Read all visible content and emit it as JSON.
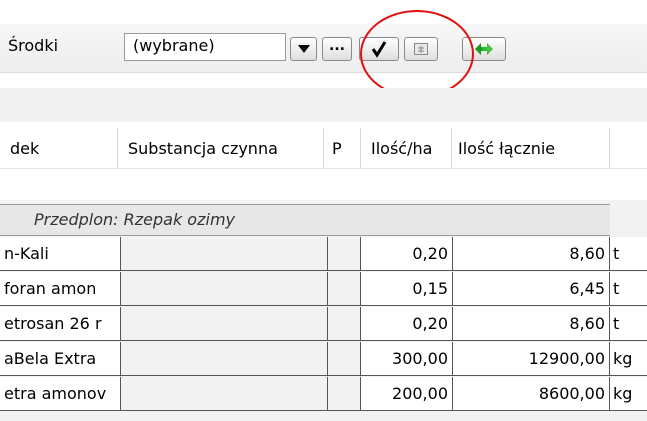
{
  "toolbar": {
    "label": "Środki",
    "combo_value": "(wybrane)",
    "more_button_label": "...",
    "check_icon": "check-icon",
    "grid_icon": "grid-icon",
    "refresh_icon": "refresh-arrows-icon",
    "highlight_color": "#e01010"
  },
  "table": {
    "columns": [
      "dek",
      "Substancja czynna",
      "P",
      "Ilość/ha",
      "Ilość łącznie"
    ],
    "group_label": "Przedplon: Rzepak ozimy",
    "rows": [
      {
        "name": "n-Kali",
        "substance": "",
        "p": "",
        "per_ha": "0,20",
        "total": "8,60",
        "unit": "t"
      },
      {
        "name": "foran amon",
        "substance": "",
        "p": "",
        "per_ha": "0,15",
        "total": "6,45",
        "unit": "t"
      },
      {
        "name": "etrosan 26 r",
        "substance": "",
        "p": "",
        "per_ha": "0,20",
        "total": "8,60",
        "unit": "t"
      },
      {
        "name": "aBela Extra",
        "substance": "",
        "p": "",
        "per_ha": "300,00",
        "total": "12900,00",
        "unit": "kg"
      },
      {
        "name": "etra amonov",
        "substance": "",
        "p": "",
        "per_ha": "200,00",
        "total": "8600,00",
        "unit": "kg"
      }
    ]
  }
}
